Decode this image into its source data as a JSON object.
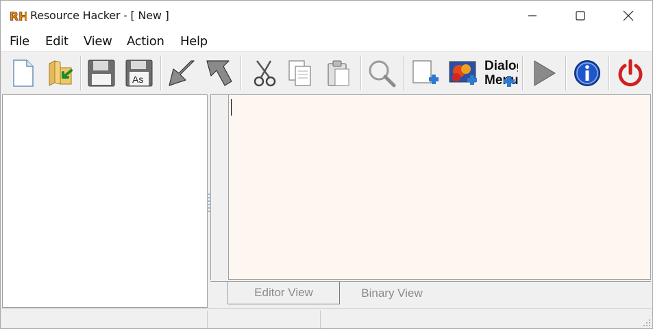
{
  "window": {
    "title": "Resource Hacker - [ New ]",
    "logo_text": "RH"
  },
  "menu": [
    "File",
    "Edit",
    "View",
    "Action",
    "Help"
  ],
  "toolbar": {
    "buttons": [
      {
        "name": "new-file",
        "icon": "new-document-icon"
      },
      {
        "name": "open-file",
        "icon": "open-folder-icon"
      },
      {
        "name": "save",
        "icon": "floppy-disk-icon"
      },
      {
        "name": "save-as",
        "icon": "save-as-icon",
        "label": "As"
      },
      {
        "name": "compile",
        "icon": "arrow-down-left-icon"
      },
      {
        "name": "decompile",
        "icon": "arrow-up-left-icon"
      },
      {
        "name": "cut",
        "icon": "scissors-icon"
      },
      {
        "name": "copy",
        "icon": "copy-icon"
      },
      {
        "name": "paste",
        "icon": "paste-icon"
      },
      {
        "name": "find",
        "icon": "magnifier-icon"
      },
      {
        "name": "add-resource",
        "icon": "add-blank-resource-icon"
      },
      {
        "name": "add-image",
        "icon": "add-image-resource-icon"
      },
      {
        "name": "dialog-menu",
        "icon": "dialog-menu-icon",
        "label_line1": "Dialog",
        "label_line2": "Menu"
      },
      {
        "name": "run-script",
        "icon": "play-icon"
      },
      {
        "name": "about",
        "icon": "info-icon"
      },
      {
        "name": "exit",
        "icon": "power-icon"
      }
    ]
  },
  "editor": {
    "content": "",
    "tabs": [
      {
        "label": "Editor View",
        "active": true
      },
      {
        "label": "Binary View",
        "active": false
      }
    ]
  },
  "colors": {
    "editor_bg": "#fdf6f1",
    "info_blue": "#1f56c9",
    "power_red": "#d02020",
    "logo_orange": "#e8891c"
  }
}
